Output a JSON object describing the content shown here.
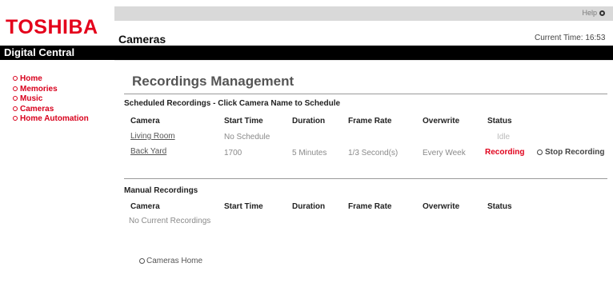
{
  "brand": {
    "logo": "TOSHIBA",
    "subtitle": "Digital Central",
    "logo_color": "#e4001b"
  },
  "nav": {
    "items": [
      {
        "label": "Home"
      },
      {
        "label": "Memories"
      },
      {
        "label": "Music"
      },
      {
        "label": "Cameras"
      },
      {
        "label": "Home Automation"
      }
    ],
    "color": "#d8001c"
  },
  "header": {
    "help_label": "Help",
    "section_title": "Cameras",
    "current_time": "Current Time: 16:53"
  },
  "main": {
    "title": "Recordings Management",
    "scheduled": {
      "heading": "Scheduled Recordings - Click Camera Name to Schedule",
      "columns": [
        "Camera",
        "Start Time",
        "Duration",
        "Frame Rate",
        "Overwrite",
        "Status"
      ],
      "rows": [
        {
          "camera": "Living Room",
          "start_time": "No Schedule",
          "duration": "",
          "frame_rate": "",
          "overwrite": "",
          "status": "Idle",
          "action": ""
        },
        {
          "camera": "Back Yard",
          "start_time": "1700",
          "duration": "5 Minutes",
          "frame_rate": "1/3 Second(s)",
          "overwrite": "Every Week",
          "status": "Recording",
          "action": "Stop Recording"
        }
      ]
    },
    "manual": {
      "heading": "Manual Recordings",
      "columns": [
        "Camera",
        "Start Time",
        "Duration",
        "Frame Rate",
        "Overwrite",
        "Status"
      ],
      "empty_text": "No Current Recordings"
    },
    "cameras_home_label": "Cameras Home"
  }
}
